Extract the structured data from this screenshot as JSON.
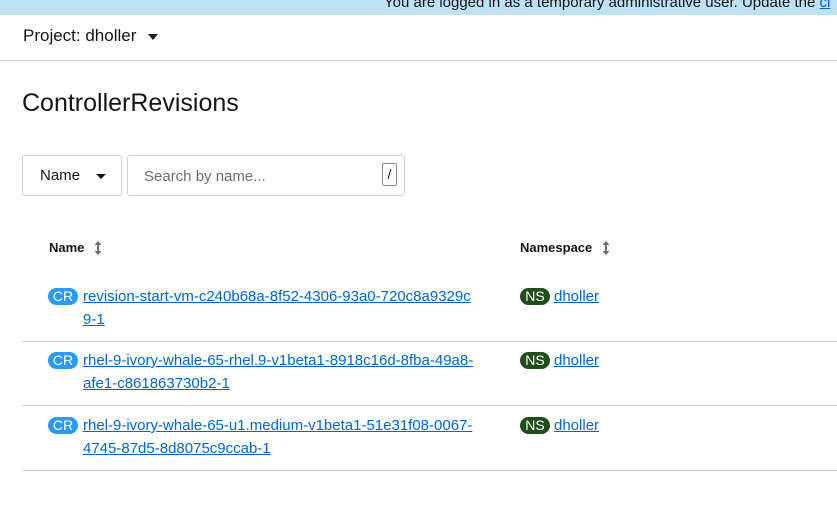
{
  "banner": {
    "text": "You are logged in as a temporary administrative user. Update the ",
    "link_text": "cl"
  },
  "project": {
    "label": "Project: dholler"
  },
  "page": {
    "title": "ControllerRevisions"
  },
  "filter": {
    "dropdown_label": "Name",
    "search_placeholder": "Search by name...",
    "shortcut_hint": "/"
  },
  "table": {
    "columns": [
      "Name",
      "Namespace"
    ],
    "rows": [
      {
        "badge": "CR",
        "name": "revision-start-vm-c240b68a-8f52-4306-93a0-720c8a9329c9-1",
        "ns_badge": "NS",
        "namespace": "dholler"
      },
      {
        "badge": "CR",
        "name": "rhel-9-ivory-whale-65-rhel.9-v1beta1-8918c16d-8fba-49a8-afe1-c861863730b2-1",
        "ns_badge": "NS",
        "namespace": "dholler"
      },
      {
        "badge": "CR",
        "name": "rhel-9-ivory-whale-65-u1.medium-v1beta1-51e31f08-0067-4745-87d5-8d8075c9ccab-1",
        "ns_badge": "NS",
        "namespace": "dholler"
      }
    ]
  },
  "colors": {
    "banner_bg": "#bee1f4",
    "link": "#0066cc",
    "cr_badge": "#2b9af3",
    "ns_badge": "#1e4f18"
  }
}
